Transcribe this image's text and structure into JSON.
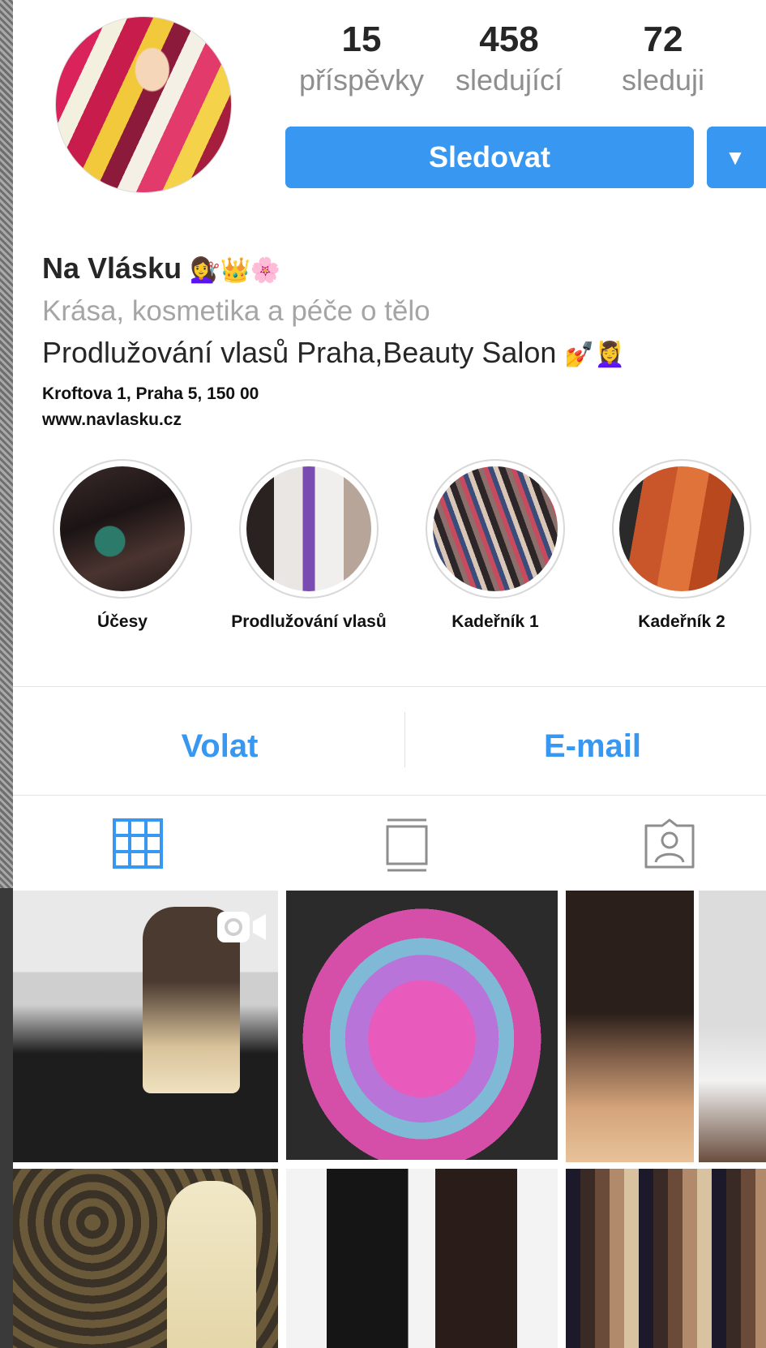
{
  "profile": {
    "name": "Na Vlásku",
    "name_emojis": "💇‍♀️👑🌸",
    "category": "Krása, kosmetika a péče o tělo",
    "description": "Prodlužování vlasů Praha,Beauty Salon",
    "description_emojis": "💅💆‍♀️",
    "address": "Kroftova 1, Praha 5, 150 00",
    "website": "www.navlasku.cz"
  },
  "stats": [
    {
      "count": "15",
      "label": "příspěvky"
    },
    {
      "count": "458",
      "label": "sledující"
    },
    {
      "count": "72",
      "label": "sleduji"
    }
  ],
  "buttons": {
    "follow_label": "Sledovat",
    "dropdown_glyph": "▼"
  },
  "highlights": [
    {
      "label": "Účesy"
    },
    {
      "label": "Prodlužování vlasů"
    },
    {
      "label": "Kadeřník 1"
    },
    {
      "label": "Kadeřník 2"
    }
  ],
  "actions": {
    "call_label": "Volat",
    "email_label": "E-mail"
  },
  "tabs": [
    {
      "icon": "grid-icon",
      "active": true
    },
    {
      "icon": "feed-icon",
      "active": false
    },
    {
      "icon": "tagged-icon",
      "active": false
    }
  ],
  "colors": {
    "accent": "#3897f0",
    "text": "#262626",
    "secondary": "#8e8e8e"
  }
}
